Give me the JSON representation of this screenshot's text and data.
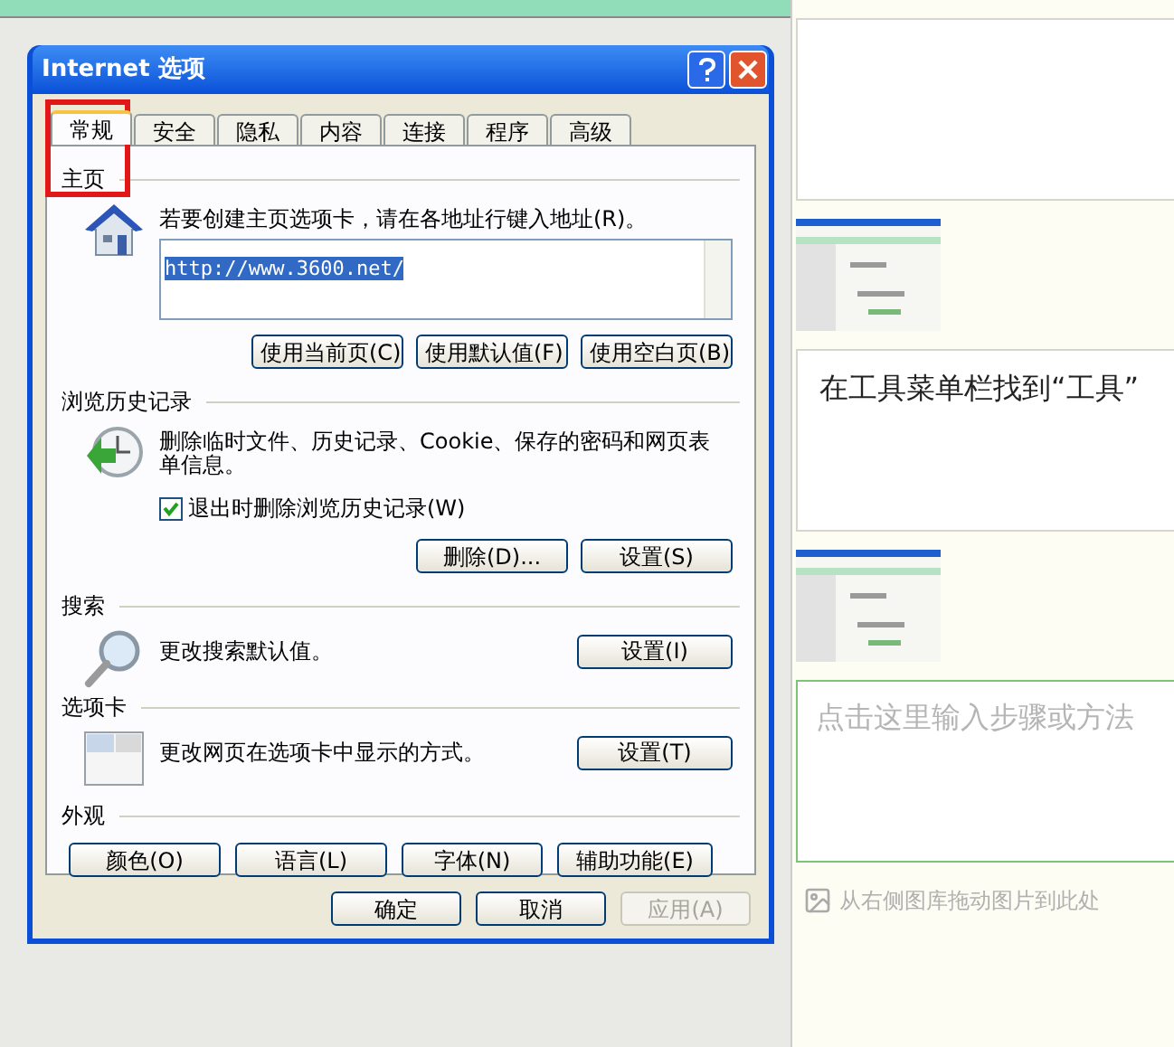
{
  "dialog": {
    "title": "Internet 选项",
    "tabs": [
      {
        "label": "常规",
        "selected": true
      },
      {
        "label": "安全",
        "selected": false
      },
      {
        "label": "隐私",
        "selected": false
      },
      {
        "label": "内容",
        "selected": false
      },
      {
        "label": "连接",
        "selected": false
      },
      {
        "label": "程序",
        "selected": false
      },
      {
        "label": "高级",
        "selected": false
      }
    ],
    "sections": [
      {
        "kind": "home",
        "title": "主页",
        "description": "若要创建主页选项卡，请在各地址行键入地址(R)。",
        "url": "http://www.3600.net/",
        "buttons": [
          "使用当前页(C)",
          "使用默认值(F)",
          "使用空白页(B)"
        ]
      },
      {
        "kind": "history",
        "title": "浏览历史记录",
        "description": "删除临时文件、历史记录、Cookie、保存的密码和网页表单信息。",
        "checkbox": {
          "label": "退出时删除浏览历史记录(W)",
          "checked": true
        },
        "buttons": [
          "删除(D)...",
          "设置(S)"
        ]
      },
      {
        "kind": "search",
        "title": "搜索",
        "description": "更改搜索默认值。",
        "buttons": [
          "设置(I)"
        ]
      },
      {
        "kind": "tabs",
        "title": "选项卡",
        "description": "更改网页在选项卡中显示的方式。",
        "buttons": [
          "设置(T)"
        ]
      },
      {
        "kind": "appearance",
        "title": "外观",
        "buttons": [
          "颜色(O)",
          "语言(L)",
          "字体(N)",
          "辅助功能(E)"
        ]
      }
    ],
    "footer_buttons": [
      {
        "label": "确定",
        "disabled": false
      },
      {
        "label": "取消",
        "disabled": false
      },
      {
        "label": "应用(A)",
        "disabled": true
      }
    ]
  },
  "editor": {
    "blocks": [
      {
        "kind": "text_box"
      },
      {
        "kind": "picture"
      },
      {
        "kind": "text_box",
        "text": "在工具菜单栏找到“工具”"
      },
      {
        "kind": "picture"
      },
      {
        "kind": "input",
        "placeholder": "点击这里输入步骤或方法"
      }
    ],
    "image_hint": "从右侧图库拖动图片到此处"
  }
}
